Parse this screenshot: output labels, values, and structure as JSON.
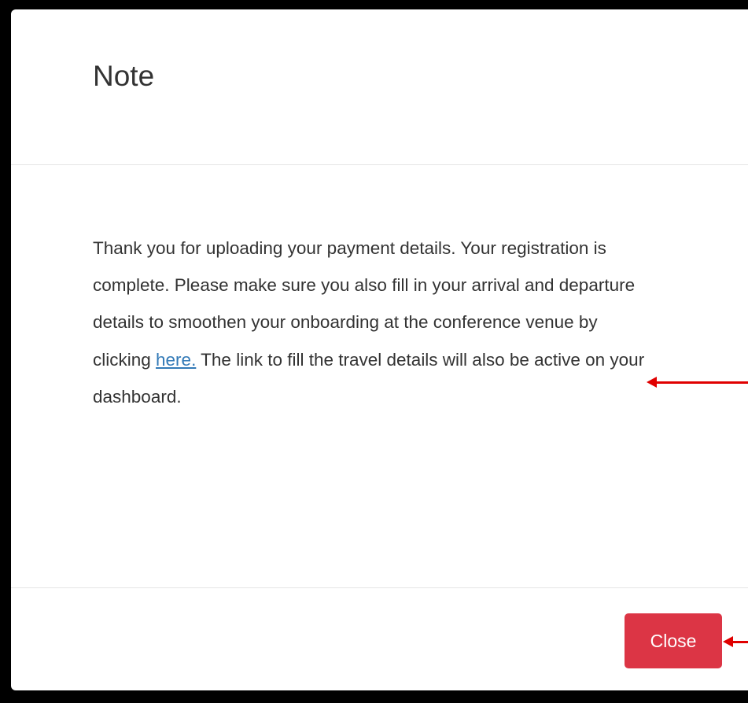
{
  "dialog": {
    "title": "Note",
    "message_before_link": "Thank you for uploading your payment details. Your registration is complete. Please make sure you also fill in your arrival and departure details to smoothen your onboarding at the conference venue by clicking ",
    "link_text": "here.",
    "message_after_link": " The link to fill the travel details will also be active on your dashboard.",
    "close_label": "Close"
  },
  "colors": {
    "close_button": "#dc3545",
    "link": "#337ab7",
    "annotation_arrow": "#e00000",
    "border": "#000000"
  }
}
